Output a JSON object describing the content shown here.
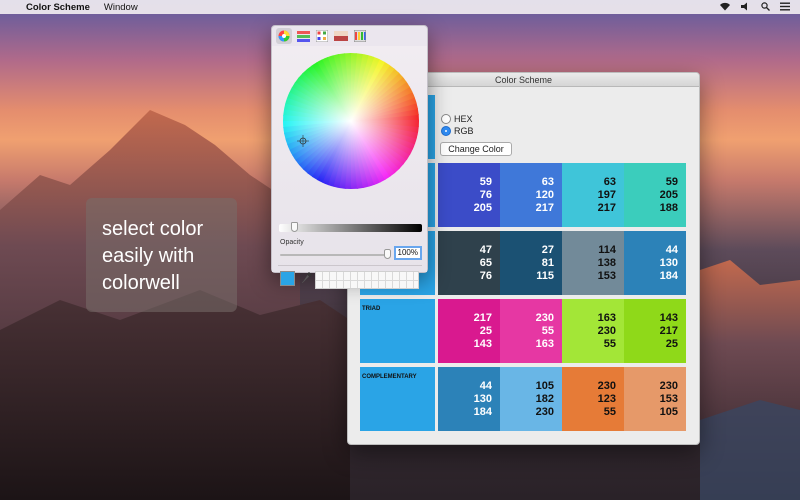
{
  "menubar": {
    "app_name": "Color Scheme",
    "menu_window": "Window"
  },
  "caption": {
    "line1": "select color",
    "line2": "easily with",
    "line3": "colorwell"
  },
  "window": {
    "title": "Color Scheme",
    "format_options": [
      {
        "label": "HEX",
        "selected": false
      },
      {
        "label": "RGB",
        "selected": true
      }
    ],
    "change_color_label": "Change Color",
    "base_color": "#2aa4e6",
    "schemes": [
      {
        "label": "",
        "swatches": [
          {
            "color": "#3b4cc8",
            "r": "59",
            "g": "76",
            "b": "205",
            "text": "#ffffff"
          },
          {
            "color": "#3f78d9",
            "r": "63",
            "g": "120",
            "b": "217",
            "text": "#ffffff"
          },
          {
            "color": "#3fc5d9",
            "r": "63",
            "g": "197",
            "b": "217",
            "text": "#111111"
          },
          {
            "color": "#3bcdbc",
            "r": "59",
            "g": "205",
            "b": "188",
            "text": "#111111"
          }
        ]
      },
      {
        "label": "",
        "swatches": [
          {
            "color": "#2f414c",
            "r": "47",
            "g": "65",
            "b": "76",
            "text": "#ffffff"
          },
          {
            "color": "#1b5173",
            "r": "27",
            "g": "81",
            "b": "115",
            "text": "#ffffff"
          },
          {
            "color": "#728a99",
            "r": "114",
            "g": "138",
            "b": "153",
            "text": "#111111"
          },
          {
            "color": "#2c82b8",
            "r": "44",
            "g": "130",
            "b": "184",
            "text": "#ffffff"
          }
        ]
      },
      {
        "label": "TRIAD",
        "swatches": [
          {
            "color": "#d9198f",
            "r": "217",
            "g": "25",
            "b": "143",
            "text": "#ffffff"
          },
          {
            "color": "#e637a3",
            "r": "230",
            "g": "55",
            "b": "163",
            "text": "#ffffff"
          },
          {
            "color": "#a3e637",
            "r": "163",
            "g": "230",
            "b": "55",
            "text": "#111111"
          },
          {
            "color": "#8fd919",
            "r": "143",
            "g": "217",
            "b": "25",
            "text": "#111111"
          }
        ]
      },
      {
        "label": "COMPLEMENTARY",
        "swatches": [
          {
            "color": "#2c82b8",
            "r": "44",
            "g": "130",
            "b": "184",
            "text": "#ffffff"
          },
          {
            "color": "#69b6e6",
            "r": "105",
            "g": "182",
            "b": "230",
            "text": "#111111"
          },
          {
            "color": "#e67b37",
            "r": "230",
            "g": "123",
            "b": "55",
            "text": "#111111"
          },
          {
            "color": "#e69969",
            "r": "230",
            "g": "153",
            "b": "105",
            "text": "#111111"
          }
        ]
      }
    ]
  },
  "picker": {
    "tabs": [
      "color-wheel",
      "color-sliders",
      "color-palettes",
      "image-palettes",
      "crayons"
    ],
    "active_tab": "color-wheel",
    "opacity_label": "Opacity",
    "opacity_value": "100%",
    "opacity_fraction": 1.0,
    "current_color": "#2aa4e6"
  }
}
